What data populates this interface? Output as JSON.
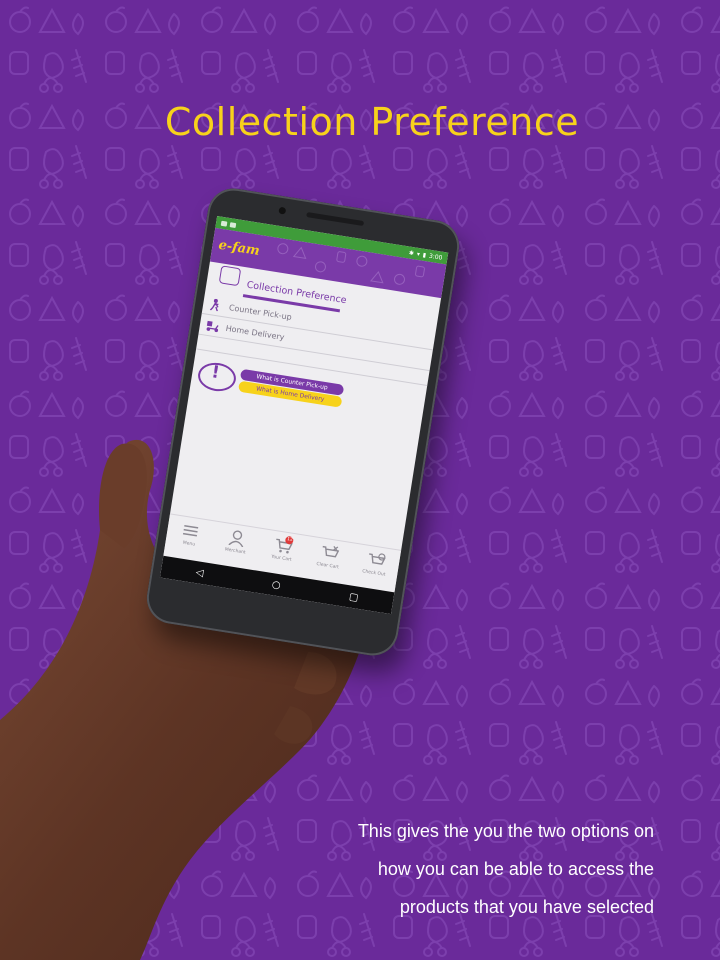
{
  "headline": "Collection Preference",
  "caption_lines": [
    "This gives the you the two options on",
    "how you can be able to access the",
    "products that you have selected"
  ],
  "colors": {
    "background": "#6a2a9a",
    "headline": "#f7d21b",
    "app_purple": "#7a3aa8",
    "app_yellow": "#f7d21b",
    "statusbar_green": "#3f9c3a"
  },
  "app": {
    "logo": "e-fam",
    "status_time": "3:00",
    "section_title": "Collection Preference",
    "options": [
      {
        "label": "Counter Pick-up",
        "icon": "person-walking-icon"
      },
      {
        "label": "Home Delivery",
        "icon": "delivery-scooter-icon"
      }
    ],
    "info_buttons": {
      "counter": "What is Counter Pick-up",
      "home": "What is Home Delivery"
    },
    "nav": [
      {
        "label": "Menu",
        "icon": "menu-icon"
      },
      {
        "label": "Merchant",
        "icon": "merchant-icon"
      },
      {
        "label": "Your Cart",
        "icon": "cart-icon",
        "badge": "12"
      },
      {
        "label": "Clear Cart",
        "icon": "clear-cart-icon"
      },
      {
        "label": "Check Out",
        "icon": "checkout-icon"
      }
    ],
    "system_buttons": [
      "back",
      "home",
      "recents"
    ]
  }
}
